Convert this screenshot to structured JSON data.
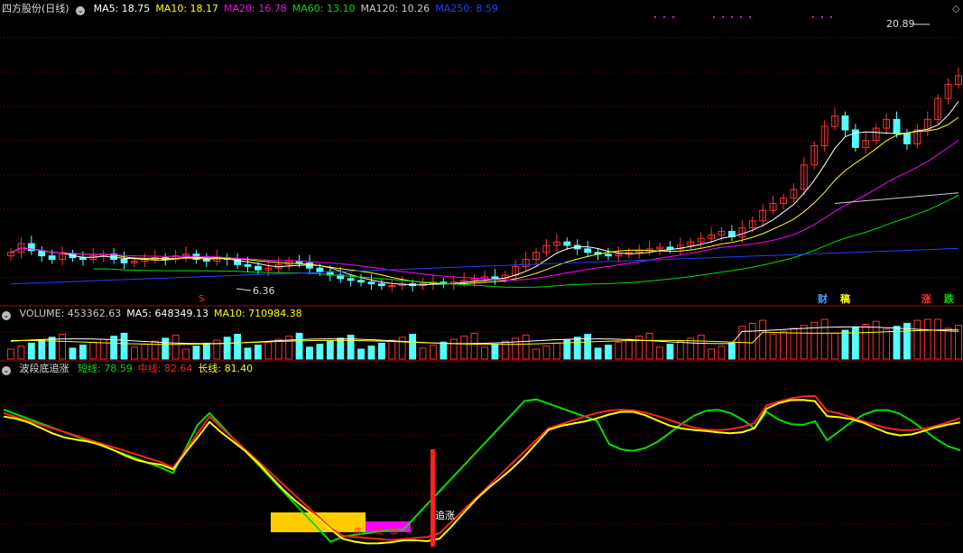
{
  "colors": {
    "up": "#ff3232",
    "down": "#54ffff",
    "ma5": "#ffffff",
    "ma10": "#ffff00",
    "ma20": "#ff00ff",
    "ma60": "#00e000",
    "ma120": "#cccccc",
    "ma250": "#2040ff",
    "short_line": "#00e000",
    "mid_line": "#ff2020",
    "long_line": "#ffff00",
    "fill_yellow": "#ffcc00",
    "fill_magenta": "#ff00ff",
    "grid": "#7a0000"
  },
  "price_panel": {
    "title": "四方股份(日线)",
    "ma_labels": [
      {
        "text": "MA5: 18.75",
        "color": "#ffffff"
      },
      {
        "text": "MA10: 18.17",
        "color": "#ffff00"
      },
      {
        "text": "MA20: 16.78",
        "color": "#ff00ff"
      },
      {
        "text": "MA60: 13.10",
        "color": "#00e000"
      },
      {
        "text": "MA120: 10.26",
        "color": "#cccccc"
      },
      {
        "text": "MA250: 8.59",
        "color": "#2040ff"
      }
    ],
    "high_annotation": "20.89",
    "low_annotation": "6.36",
    "badges": [
      {
        "text": "财",
        "color": "#40a0ff"
      },
      {
        "text": "稿",
        "color": "#ffff00"
      },
      {
        "text": "涨",
        "color": "#ff3232"
      },
      {
        "text": "跌",
        "color": "#00e000"
      }
    ],
    "marker_s": "S"
  },
  "volume_panel": {
    "labels": [
      {
        "text": "VOLUME: 453362.63",
        "color": "#cccccc"
      },
      {
        "text": "MA5: 648349.13",
        "color": "#ffffff"
      },
      {
        "text": "MA10: 710984.38",
        "color": "#ffff00"
      }
    ]
  },
  "indicator_panel": {
    "title": "波段底追涨",
    "labels": [
      {
        "text": "短线: 78.59",
        "color": "#00e000"
      },
      {
        "text": "中线: 82.64",
        "color": "#ff2020"
      },
      {
        "text": "长线: 81.40",
        "color": "#ffff00"
      }
    ],
    "signal_label": "追涨",
    "bottom_label": "底"
  },
  "chart_data": {
    "type": "candlestick",
    "title": "四方股份(日线)",
    "price_range": [
      5.5,
      22
    ],
    "high": 20.89,
    "low": 6.36,
    "candles_note": "approximate OHLC read from chart, 93 trading days",
    "closes": [
      8.4,
      8.9,
      8.5,
      8.2,
      8.0,
      8.3,
      8.1,
      8.0,
      8.2,
      8.3,
      8.0,
      7.8,
      7.9,
      8.0,
      8.1,
      8.0,
      8.2,
      8.3,
      8.0,
      7.9,
      8.1,
      8.0,
      7.7,
      7.6,
      7.4,
      7.5,
      7.7,
      7.9,
      7.8,
      7.5,
      7.3,
      7.1,
      6.9,
      6.8,
      6.7,
      6.6,
      6.5,
      6.5,
      6.6,
      6.5,
      6.6,
      6.7,
      6.6,
      6.7,
      6.8,
      6.9,
      7.0,
      6.9,
      7.1,
      7.6,
      8.0,
      8.4,
      8.8,
      9.0,
      8.8,
      8.6,
      8.4,
      8.3,
      8.2,
      8.3,
      8.4,
      8.5,
      8.6,
      8.7,
      8.6,
      8.8,
      9.0,
      9.2,
      9.4,
      9.6,
      9.3,
      9.8,
      10.2,
      10.8,
      11.2,
      11.5,
      12.0,
      13.4,
      14.5,
      15.6,
      16.2,
      15.4,
      14.4,
      14.8,
      15.5,
      16.0,
      15.2,
      14.6,
      15.4,
      16.0,
      17.2,
      18.0,
      18.5
    ],
    "ma_series_note": "MA5/10/20/60/120/250 overlaid on price panel",
    "volume": {
      "ylabel": "VOLUME",
      "last": 453362.63,
      "ma5": 648349.13,
      "ma10": 710984.38
    },
    "indicator": {
      "name": "波段底追涨",
      "range": [
        0,
        100
      ],
      "short": {
        "name": "短线",
        "last": 78.59
      },
      "mid": {
        "name": "中线",
        "last": 82.64
      },
      "long": {
        "name": "长线",
        "last": 81.4
      }
    }
  }
}
